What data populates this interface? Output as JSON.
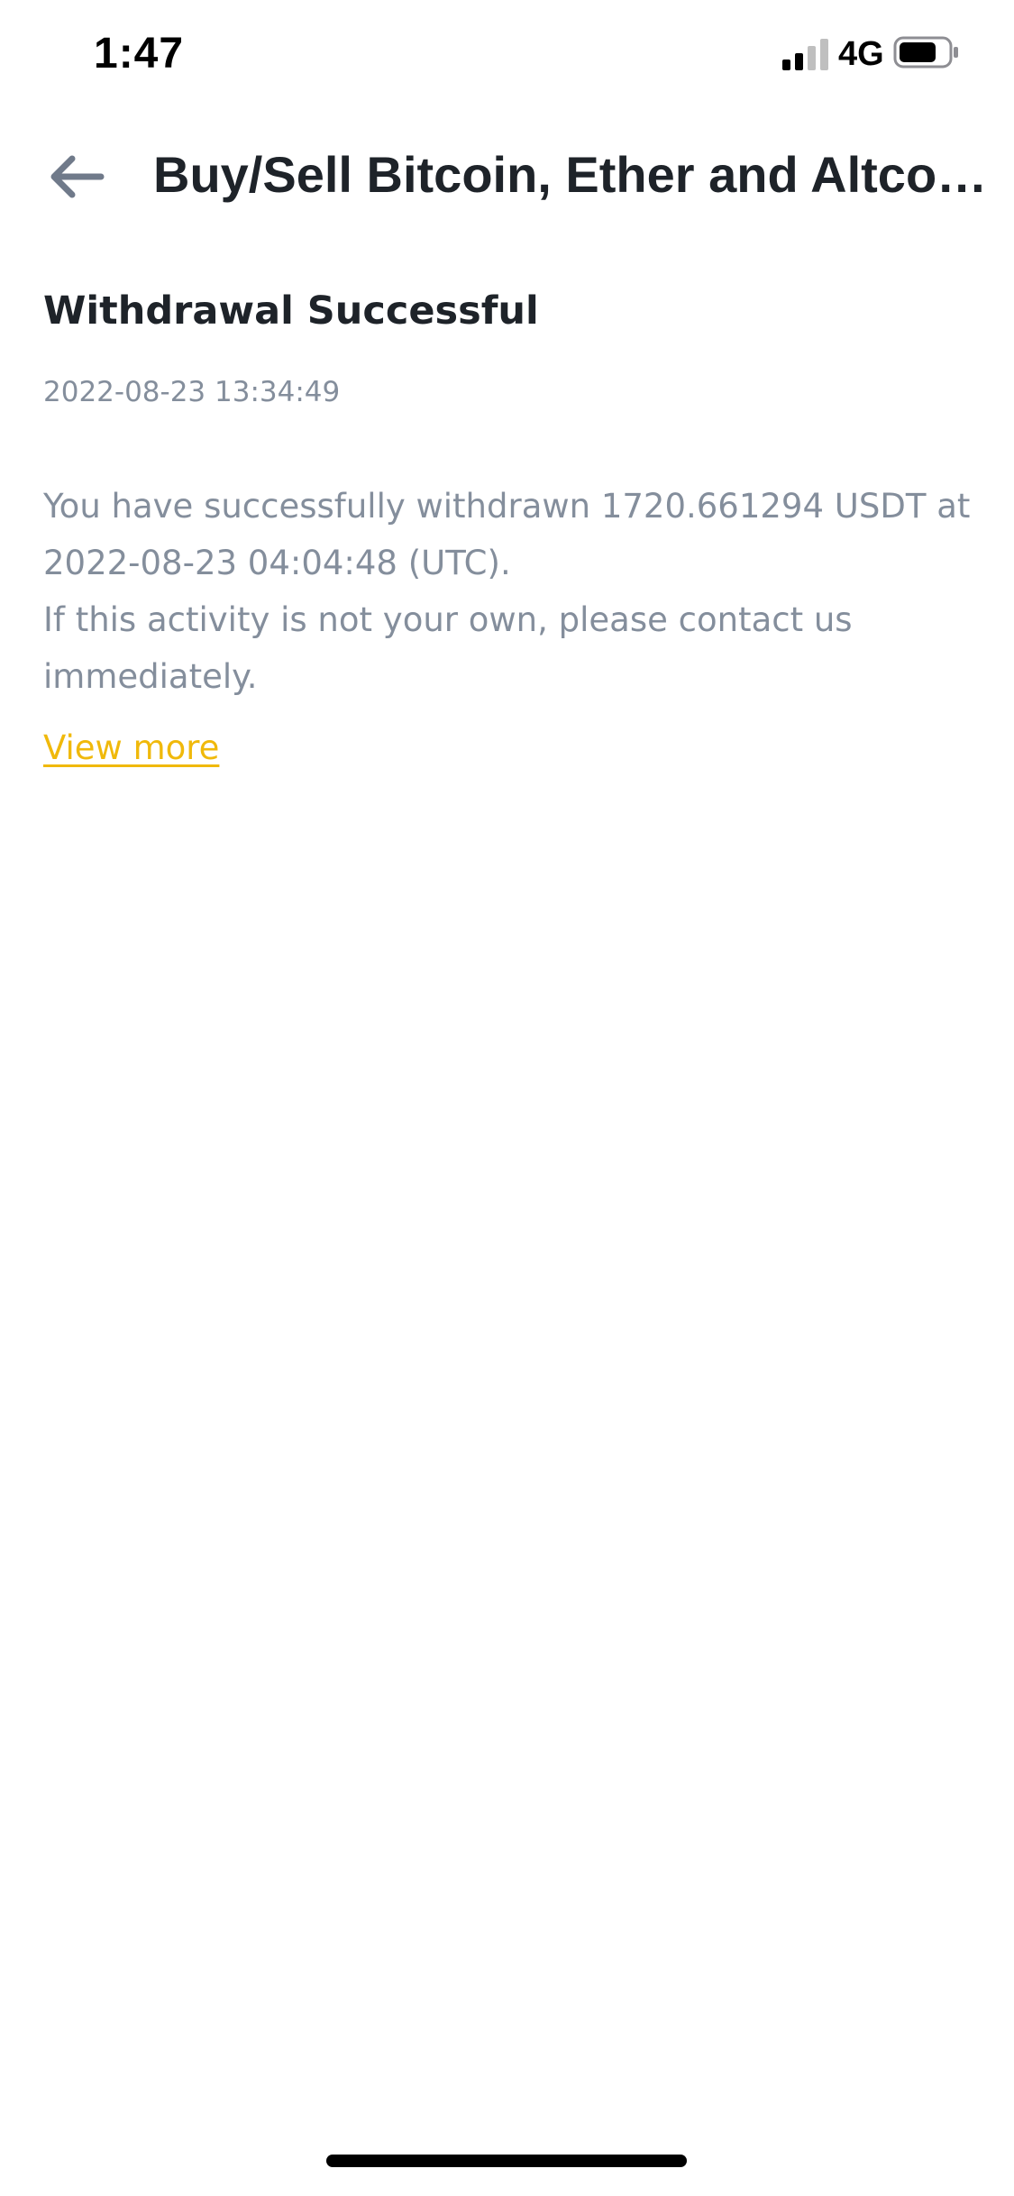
{
  "status_bar": {
    "time": "1:47",
    "network": "4G",
    "signal_icon": "cellular-signal-icon",
    "battery_icon": "battery-icon"
  },
  "header": {
    "back_icon": "arrow-left-icon",
    "title": "Buy/Sell Bitcoin, Ether and Altcoins"
  },
  "notice": {
    "title": "Withdrawal Successful",
    "date": "2022-08-23 13:34:49",
    "body_line_1": "You have successfully withdrawn 1720.661294 USDT at 2022-08-23 04:04:48 (UTC).",
    "body_line_2": "If this activity is not your own, please contact us immediately.",
    "link_label": "View more"
  },
  "colors": {
    "title_text": "#1E2329",
    "secondary_text": "#848E9C",
    "link": "#F0B90B",
    "background": "#FFFFFF"
  }
}
